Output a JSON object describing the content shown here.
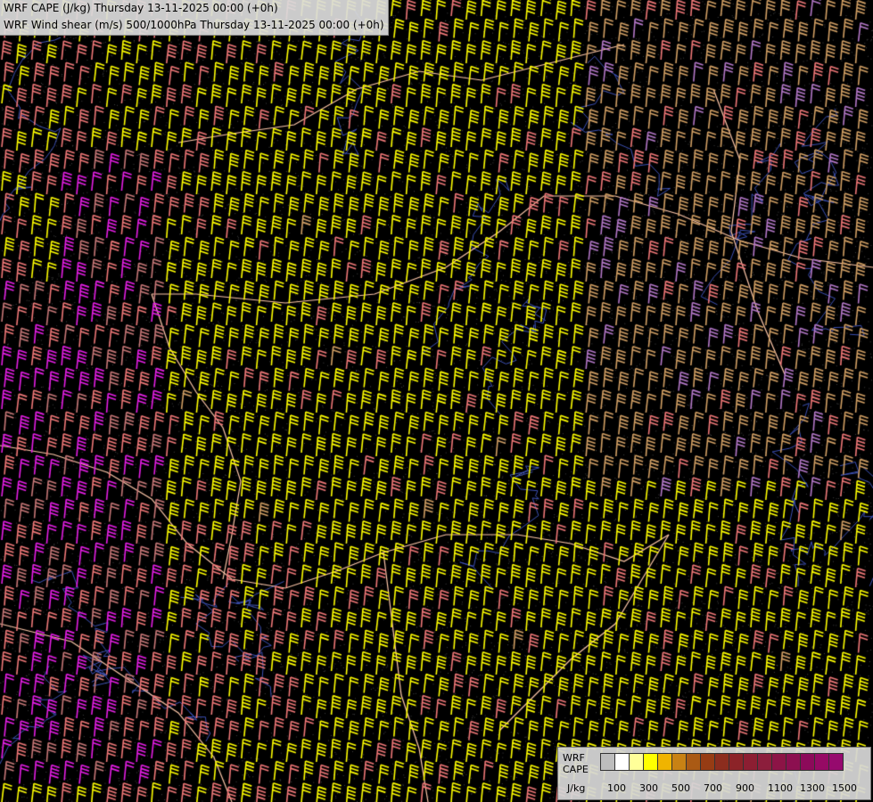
{
  "title": {
    "line1": "WRF CAPE (J/kg) Thursday 13-11-2025 00:00 (+0h)",
    "line2": "WRF Wind shear (m/s) 500/1000hPa Thursday 13-11-2025 00:00 (+0h)"
  },
  "legend": {
    "title_line1": "WRF",
    "title_line2": "CAPE",
    "unit": "J/kg",
    "colors": [
      "#bdbdbd",
      "#ffffff",
      "#ffff99",
      "#ffff00",
      "#f0b400",
      "#c88214",
      "#aa5a14",
      "#963c14",
      "#8c2d1e",
      "#8c2328",
      "#8c1e32",
      "#8c1e3c",
      "#8c1446",
      "#8c0f50",
      "#8c0a5a",
      "#960a64",
      "#960a6e"
    ],
    "ticks": [
      "100",
      "300",
      "500",
      "700",
      "900",
      "1100",
      "1300",
      "1500"
    ]
  },
  "barb_palette": {
    "yellow": "#ffff00",
    "salmon": "#f07878",
    "tan": "#d2a064",
    "magenta": "#e61ee6",
    "pink": "#c87878",
    "violet": "#b478c8",
    "border": "#ffc8aa",
    "river": "#3c50b4"
  }
}
